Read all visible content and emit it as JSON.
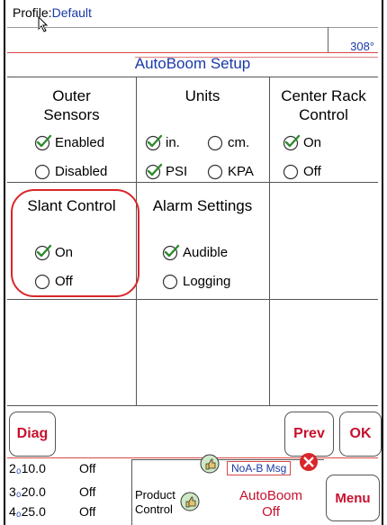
{
  "header": {
    "profile_label": "Profile:",
    "profile_value": "Default",
    "angle": "308°"
  },
  "title": "AutoBoom Setup",
  "outer_sensors": {
    "heading_line1": "Outer",
    "heading_line2": "Sensors",
    "enabled_label": "Enabled",
    "disabled_label": "Disabled",
    "selected": "Enabled"
  },
  "units": {
    "heading": "Units",
    "in_label": "in.",
    "cm_label": "cm.",
    "psi_label": "PSI",
    "kpa_label": "KPA",
    "length_selected": "in.",
    "pressure_selected": "PSI"
  },
  "center_rack": {
    "heading_line1": "Center Rack",
    "heading_line2": "Control",
    "on_label": "On",
    "off_label": "Off",
    "selected": "On"
  },
  "slant_control": {
    "heading": "Slant Control",
    "on_label": "On",
    "off_label": "Off",
    "selected": "On"
  },
  "alarm_settings": {
    "heading": "Alarm Settings",
    "audible_label": "Audible",
    "logging_label": "Logging",
    "selected": "Audible"
  },
  "buttons": {
    "diag": "Diag",
    "prev": "Prev",
    "ok": "OK",
    "menu": "Menu"
  },
  "bottom": {
    "rows": [
      {
        "index": "2",
        "value": "10.0",
        "state": "Off"
      },
      {
        "index": "3",
        "value": "20.0",
        "state": "Off"
      },
      {
        "index": "4",
        "value": "25.0",
        "state": "Off"
      }
    ],
    "nob_msg": "NoA-B Msg",
    "product_line1": "Product",
    "product_line2": "Control",
    "autoboom_line1": "AutoBoom",
    "autoboom_line2": "Off"
  },
  "colors": {
    "accent_blue": "#1a3aa8",
    "button_red": "#c8102e",
    "highlight_red": "#d9262a",
    "check_green": "#2e8b2e"
  }
}
